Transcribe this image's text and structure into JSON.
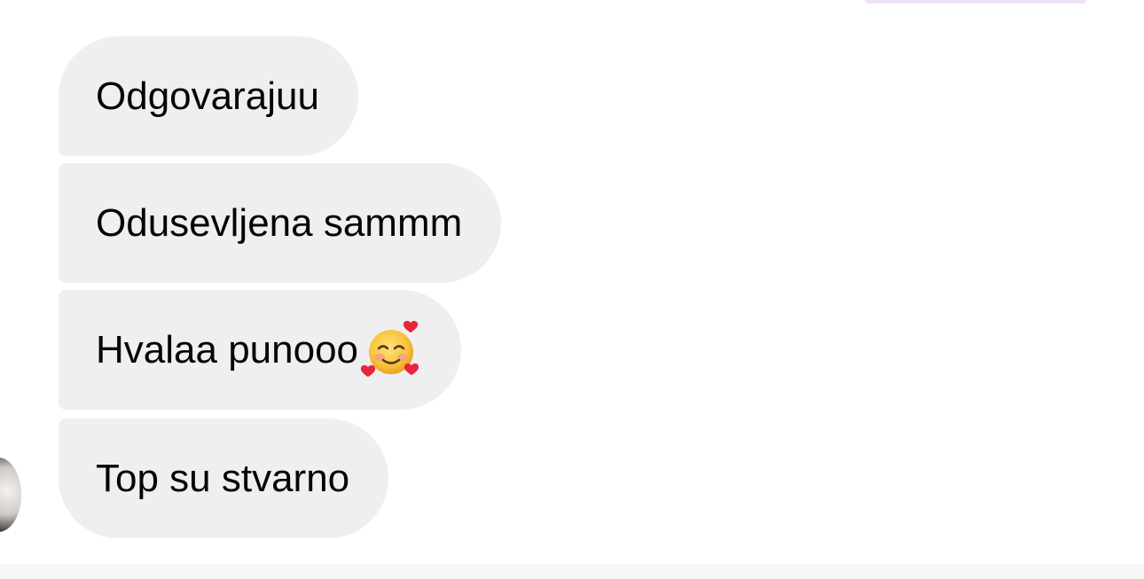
{
  "thread": {
    "messages": [
      {
        "text": "Odgovarajuu"
      },
      {
        "text": "Odusevljena sammm"
      },
      {
        "text": "Hvalaa punooo",
        "emoji": "smiling-face-with-hearts-icon"
      },
      {
        "text": "Top su stvarno"
      }
    ]
  },
  "colors": {
    "bubble_bg": "#efefef",
    "text": "#050505",
    "page_bg": "#ffffff"
  }
}
